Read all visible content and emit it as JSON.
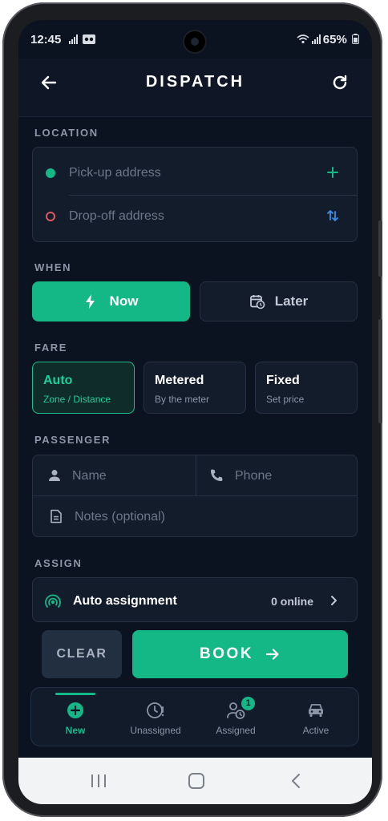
{
  "status_bar": {
    "time": "12:45",
    "battery": "65%"
  },
  "header": {
    "title": "DISPATCH"
  },
  "location": {
    "section_label": "LOCATION",
    "pickup_placeholder": "Pick-up address",
    "dropoff_placeholder": "Drop-off address"
  },
  "when": {
    "section_label": "WHEN",
    "now_label": "Now",
    "later_label": "Later",
    "selected": "Now"
  },
  "fare": {
    "section_label": "FARE",
    "options": [
      {
        "title": "Auto",
        "subtitle": "Zone / Distance",
        "selected": true
      },
      {
        "title": "Metered",
        "subtitle": "By the meter",
        "selected": false
      },
      {
        "title": "Fixed",
        "subtitle": "Set price",
        "selected": false
      }
    ]
  },
  "passenger": {
    "section_label": "PASSENGER",
    "name_placeholder": "Name",
    "phone_placeholder": "Phone",
    "notes_placeholder": "Notes (optional)"
  },
  "assign": {
    "section_label": "ASSIGN",
    "mode_label": "Auto assignment",
    "online_count": "0 online"
  },
  "actions": {
    "clear_label": "CLEAR",
    "book_label": "BOOK"
  },
  "bottom_nav": {
    "items": [
      {
        "label": "New",
        "active": true
      },
      {
        "label": "Unassigned",
        "active": false
      },
      {
        "label": "Assigned",
        "active": false,
        "badge": "1"
      },
      {
        "label": "Active",
        "active": false
      }
    ]
  },
  "colors": {
    "accent": "#14b887",
    "background": "#0b1320",
    "card": "#131c2b",
    "dropoff_marker": "#e0575f",
    "swap_icon": "#3b8ee8"
  }
}
